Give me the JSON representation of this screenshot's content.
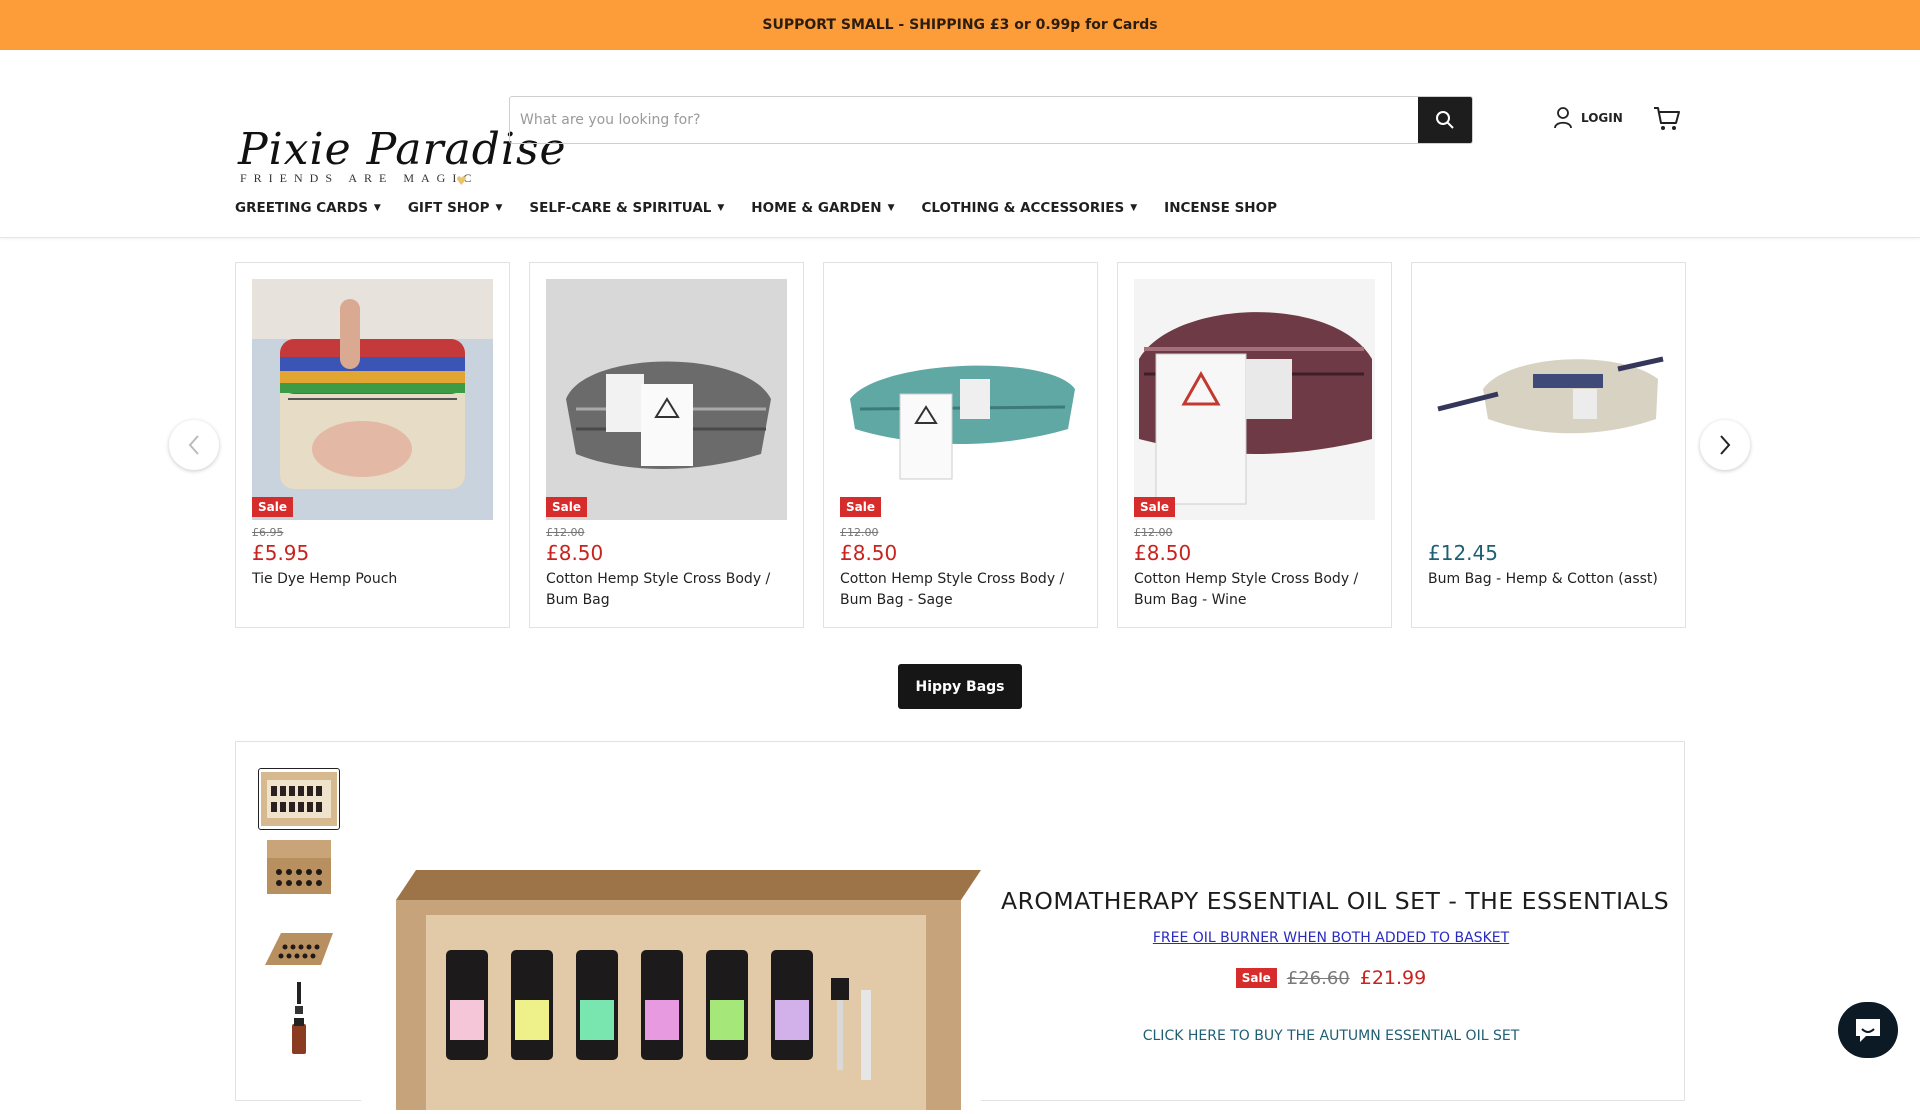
{
  "announcement": "SUPPORT SMALL - SHIPPING £3 or 0.99p for Cards",
  "logo": {
    "name": "Pixie Paradise",
    "tagline": "FRIENDS ARE MAGIC"
  },
  "search": {
    "placeholder": "What are you looking for?"
  },
  "header": {
    "login_label": "LOGIN"
  },
  "nav": [
    {
      "label": "GREETING CARDS",
      "has_dropdown": true
    },
    {
      "label": "GIFT SHOP",
      "has_dropdown": true
    },
    {
      "label": "SELF-CARE & SPIRITUAL",
      "has_dropdown": true
    },
    {
      "label": "HOME & GARDEN",
      "has_dropdown": true
    },
    {
      "label": "CLOTHING & ACCESSORIES",
      "has_dropdown": true
    },
    {
      "label": "INCENSE SHOP",
      "has_dropdown": false
    }
  ],
  "products": [
    {
      "badge": "Sale",
      "was": "£6.95",
      "price": "£5.95",
      "title": "Tie Dye Hemp Pouch"
    },
    {
      "badge": "Sale",
      "was": "£12.00",
      "price": "£8.50",
      "title": "Cotton Hemp Style Cross Body / Bum Bag"
    },
    {
      "badge": "Sale",
      "was": "£12.00",
      "price": "£8.50",
      "title": "Cotton Hemp Style Cross Body / Bum Bag - Sage"
    },
    {
      "badge": "Sale",
      "was": "£12.00",
      "price": "£8.50",
      "title": "Cotton Hemp Style Cross Body / Bum Bag - Wine"
    },
    {
      "badge": "",
      "was": "",
      "price": "£12.45",
      "title": "Bum Bag - Hemp & Cotton (asst)"
    }
  ],
  "collection_button": "Hippy Bags",
  "feature": {
    "title": "AROMATHERAPY ESSENTIAL OIL SET - THE ESSENTIALS",
    "promo_link": "FREE OIL BURNER WHEN BOTH ADDED TO BASKET",
    "badge": "Sale",
    "was": "£26.60",
    "price": "£21.99",
    "autumn_link": "CLICK HERE TO BUY THE AUTUMN ESSENTIAL OIL SET"
  },
  "colors": {
    "announcement_bg": "#fd9d3a",
    "sale_red": "#d72c2c",
    "price_red": "#c7231f",
    "accent_teal": "#1f5f74"
  },
  "icons": [
    "search-icon",
    "user-icon",
    "cart-icon",
    "chevron-left-icon",
    "chevron-right-icon",
    "chat-icon"
  ]
}
